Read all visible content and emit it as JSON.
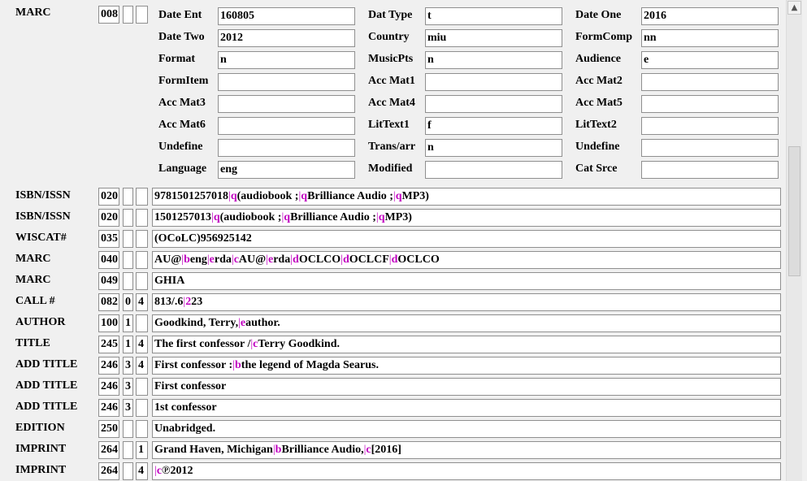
{
  "fixed": {
    "label": "MARC",
    "tag": "008",
    "fields": [
      {
        "label": "Date Ent",
        "value": "160805"
      },
      {
        "label": "Dat Type",
        "value": "t"
      },
      {
        "label": "Date One",
        "value": "2016"
      },
      {
        "label": "Date Two",
        "value": "2012"
      },
      {
        "label": "Country",
        "value": "miu"
      },
      {
        "label": "FormComp",
        "value": "nn"
      },
      {
        "label": "Format",
        "value": "n"
      },
      {
        "label": "MusicPts",
        "value": "n"
      },
      {
        "label": "Audience",
        "value": "e"
      },
      {
        "label": "FormItem",
        "value": ""
      },
      {
        "label": "Acc Mat1",
        "value": ""
      },
      {
        "label": "Acc Mat2",
        "value": ""
      },
      {
        "label": "Acc Mat3",
        "value": ""
      },
      {
        "label": "Acc Mat4",
        "value": ""
      },
      {
        "label": "Acc Mat5",
        "value": ""
      },
      {
        "label": "Acc Mat6",
        "value": ""
      },
      {
        "label": "LitText1",
        "value": "f"
      },
      {
        "label": "LitText2",
        "value": ""
      },
      {
        "label": "Undefine",
        "value": ""
      },
      {
        "label": "Trans/arr",
        "value": "n"
      },
      {
        "label": "Undefine",
        "value": ""
      },
      {
        "label": "Language",
        "value": "eng"
      },
      {
        "label": "Modified",
        "value": ""
      },
      {
        "label": "Cat Srce",
        "value": ""
      }
    ]
  },
  "records": [
    {
      "label": "ISBN/ISSN",
      "tag": "020",
      "ind1": "",
      "ind2": "",
      "parts": [
        {
          "t": "9781501257018"
        },
        {
          "c": "q"
        },
        {
          "t": "(audiobook ;"
        },
        {
          "c": "q"
        },
        {
          "t": "Brilliance Audio ;"
        },
        {
          "c": "q"
        },
        {
          "t": "MP3)"
        }
      ]
    },
    {
      "label": "ISBN/ISSN",
      "tag": "020",
      "ind1": "",
      "ind2": "",
      "parts": [
        {
          "t": "1501257013"
        },
        {
          "c": "q"
        },
        {
          "t": "(audiobook ;"
        },
        {
          "c": "q"
        },
        {
          "t": "Brilliance Audio ;"
        },
        {
          "c": "q"
        },
        {
          "t": "MP3)"
        }
      ]
    },
    {
      "label": "WISCAT#",
      "tag": "035",
      "ind1": "",
      "ind2": "",
      "parts": [
        {
          "t": "(OCoLC)956925142"
        }
      ]
    },
    {
      "label": "MARC",
      "tag": "040",
      "ind1": "",
      "ind2": "",
      "parts": [
        {
          "t": "AU@"
        },
        {
          "c": "b"
        },
        {
          "t": "eng"
        },
        {
          "c": "e"
        },
        {
          "t": "rda"
        },
        {
          "c": "c"
        },
        {
          "t": "AU@"
        },
        {
          "c": "e"
        },
        {
          "t": "rda"
        },
        {
          "c": "d"
        },
        {
          "t": "OCLCO"
        },
        {
          "c": "d"
        },
        {
          "t": "OCLCF"
        },
        {
          "c": "d"
        },
        {
          "t": "OCLCO"
        }
      ]
    },
    {
      "label": "MARC",
      "tag": "049",
      "ind1": "",
      "ind2": "",
      "parts": [
        {
          "t": "GHIA"
        }
      ]
    },
    {
      "label": "CALL #",
      "tag": "082",
      "ind1": "0",
      "ind2": "4",
      "parts": [
        {
          "t": "813/.6"
        },
        {
          "c": "2"
        },
        {
          "t": "23"
        }
      ]
    },
    {
      "label": "AUTHOR",
      "tag": "100",
      "ind1": "1",
      "ind2": "",
      "parts": [
        {
          "t": "Goodkind, Terry,"
        },
        {
          "c": "e"
        },
        {
          "t": "author."
        }
      ]
    },
    {
      "label": "TITLE",
      "tag": "245",
      "ind1": "1",
      "ind2": "4",
      "parts": [
        {
          "t": "The first confessor /"
        },
        {
          "c": "c"
        },
        {
          "t": "Terry Goodkind."
        }
      ]
    },
    {
      "label": "ADD TITLE",
      "tag": "246",
      "ind1": "3",
      "ind2": "4",
      "parts": [
        {
          "t": "First confessor :"
        },
        {
          "c": "b"
        },
        {
          "t": "the legend of Magda Searus."
        }
      ]
    },
    {
      "label": "ADD TITLE",
      "tag": "246",
      "ind1": "3",
      "ind2": "",
      "parts": [
        {
          "t": "First confessor"
        }
      ]
    },
    {
      "label": "ADD TITLE",
      "tag": "246",
      "ind1": "3",
      "ind2": "",
      "parts": [
        {
          "t": "1st confessor"
        }
      ]
    },
    {
      "label": "EDITION",
      "tag": "250",
      "ind1": "",
      "ind2": "",
      "parts": [
        {
          "t": "Unabridged."
        }
      ]
    },
    {
      "label": "IMPRINT",
      "tag": "264",
      "ind1": "",
      "ind2": "1",
      "parts": [
        {
          "t": "Grand Haven, Michigan"
        },
        {
          "c": "b"
        },
        {
          "t": "Brilliance Audio,"
        },
        {
          "c": "c"
        },
        {
          "t": "[2016]"
        }
      ]
    },
    {
      "label": "IMPRINT",
      "tag": "264",
      "ind1": "",
      "ind2": "4",
      "parts": [
        {
          "c": "c"
        },
        {
          "t": "℗2012"
        }
      ]
    }
  ],
  "scrollbar": {
    "up_arrow": "▲"
  },
  "colors": {
    "subfield": "#c000c0",
    "background": "#f0f0f0",
    "field_bg": "#ffffff",
    "border": "#8f8f8f"
  }
}
